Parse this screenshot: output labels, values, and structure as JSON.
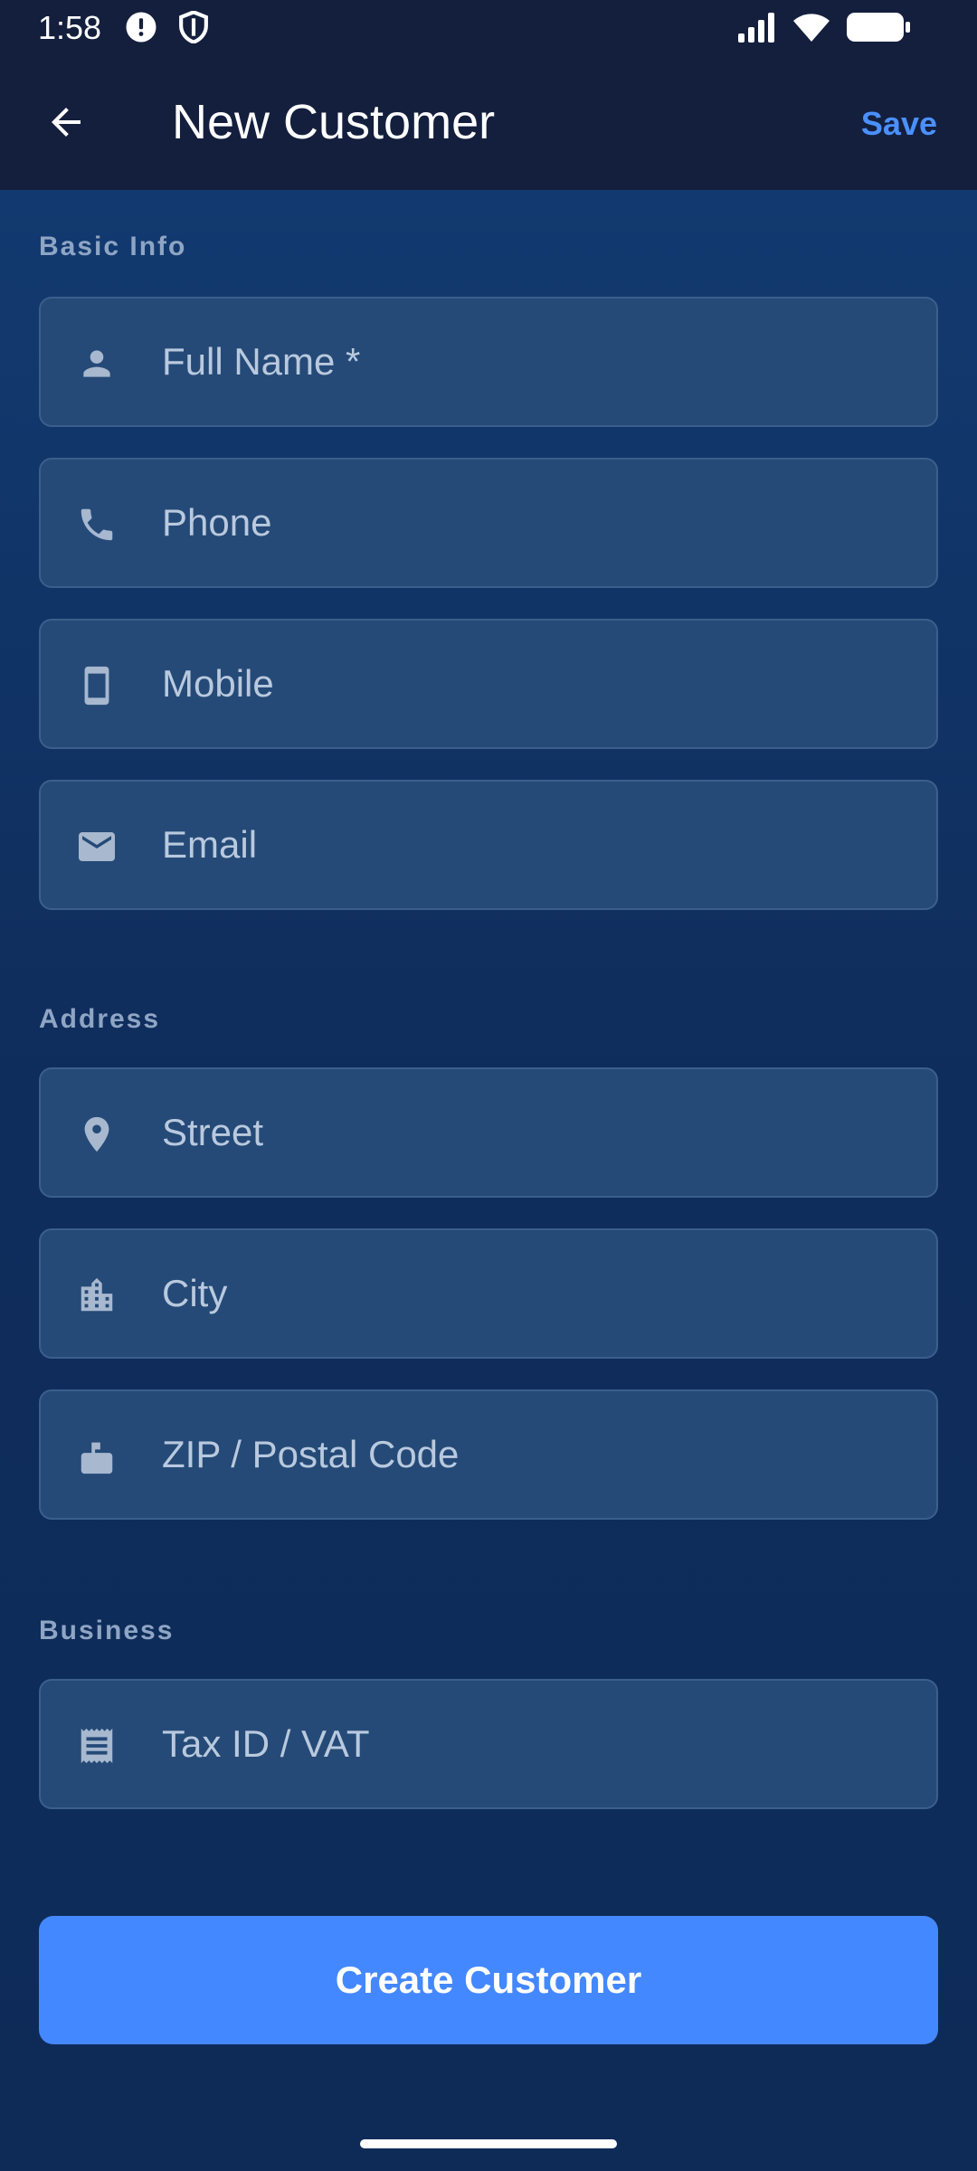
{
  "status_bar": {
    "time": "1:58",
    "icons": [
      "alert-icon",
      "shield-icon",
      "signal-icon",
      "wifi-icon",
      "battery-icon"
    ]
  },
  "app_bar": {
    "title": "New Customer",
    "save_label": "Save",
    "back_icon": "arrow-back-icon"
  },
  "sections": {
    "basic_info": "Basic Info",
    "address": "Address",
    "business": "Business"
  },
  "fields": {
    "full_name": {
      "placeholder": "Full Name *",
      "value": "",
      "icon": "person-icon"
    },
    "phone": {
      "placeholder": "Phone",
      "value": "",
      "icon": "phone-icon"
    },
    "mobile": {
      "placeholder": "Mobile",
      "value": "",
      "icon": "smartphone-icon"
    },
    "email": {
      "placeholder": "Email",
      "value": "",
      "icon": "mail-icon"
    },
    "street": {
      "placeholder": "Street",
      "value": "",
      "icon": "location-pin-icon"
    },
    "city": {
      "placeholder": "City",
      "value": "",
      "icon": "city-icon"
    },
    "zip": {
      "placeholder": "ZIP / Postal Code",
      "value": "",
      "icon": "mailbox-icon"
    },
    "tax_id": {
      "placeholder": "Tax ID / VAT",
      "value": "",
      "icon": "receipt-icon"
    }
  },
  "actions": {
    "create_label": "Create Customer"
  },
  "colors": {
    "accent": "#4488ff",
    "save_text": "#4a90ff",
    "app_bar_bg": "#141f3d",
    "field_bg": "#254a77",
    "icon_color": "#a7b8cf"
  }
}
